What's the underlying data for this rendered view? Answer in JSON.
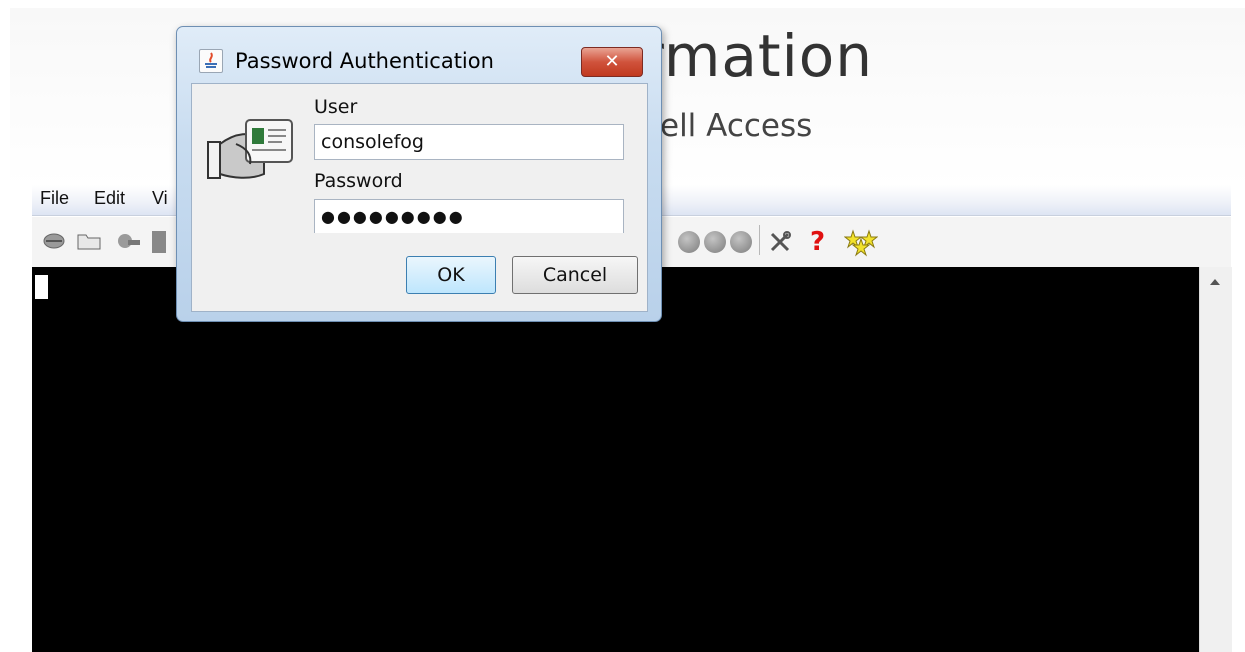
{
  "background_page": {
    "title_fragment": "rmation",
    "subtitle_fragment": "ell Access"
  },
  "menubar": {
    "items": [
      "File",
      "Edit",
      "Vi"
    ]
  },
  "toolbar": {
    "icons": [
      "connect-icon",
      "open-folder-icon",
      "key-icon",
      "save-icon",
      "record-icon",
      "record-icon",
      "record-icon",
      "tools-icon",
      "help-icon",
      "stars-icon"
    ],
    "help_glyph": "?"
  },
  "dialog": {
    "title": "Password Authentication",
    "close_glyph": "✕",
    "user_label": "User",
    "user_value": "consolefog",
    "password_label": "Password",
    "password_value": "●●●●●●●●●",
    "ok_label": "OK",
    "cancel_label": "Cancel"
  },
  "colors": {
    "terminal_bg": "#000000",
    "dialog_frame": "#b9d1ea",
    "close_button": "#c0391f"
  }
}
